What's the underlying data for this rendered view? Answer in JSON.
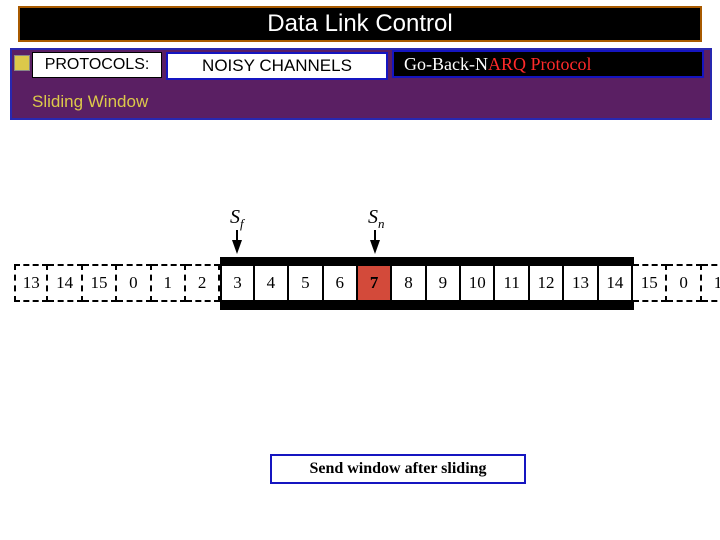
{
  "title": "Data Link Control",
  "protocols_label": "PROTOCOLS:",
  "noisy_label": "NOISY CHANNELS",
  "goback_prefix": "Go-Back-N ",
  "goback_red": "ARQ Protocol",
  "subhead": "Sliding Window",
  "pointer_sf": "S",
  "pointer_sf_sub": "f",
  "pointer_sn": "S",
  "pointer_sn_sub": "n",
  "caption": "Send window after sliding",
  "chart_data": {
    "type": "table",
    "description": "Go-Back-N send sliding window after sliding",
    "sequence": [
      13,
      14,
      15,
      0,
      1,
      2,
      3,
      4,
      5,
      6,
      7,
      8,
      9,
      10,
      11,
      12,
      13,
      14,
      15,
      0,
      1
    ],
    "pre_window": [
      13,
      14,
      15,
      0,
      1,
      2
    ],
    "in_window": [
      3,
      4,
      5,
      6,
      7,
      8,
      9,
      10,
      11,
      12,
      13,
      14
    ],
    "post_window": [
      15,
      0,
      1
    ],
    "Sf_index": 6,
    "Sf_value": 3,
    "Sn_index": 10,
    "Sn_value": 7,
    "outstanding_sent": [
      3,
      4,
      5,
      6
    ],
    "next_to_send": 7,
    "window_size_frames": 12,
    "sequence_number_space": 16
  },
  "cells": {
    "c0": "13",
    "c1": "14",
    "c2": "15",
    "c3": "0",
    "c4": "1",
    "c5": "2",
    "c6": "3",
    "c7": "4",
    "c8": "5",
    "c9": "6",
    "c10": "7",
    "c11": "8",
    "c12": "9",
    "c13": "10",
    "c14": "11",
    "c15": "12",
    "c16": "13",
    "c17": "14",
    "c18": "15",
    "c19": "0",
    "c20": "1"
  }
}
